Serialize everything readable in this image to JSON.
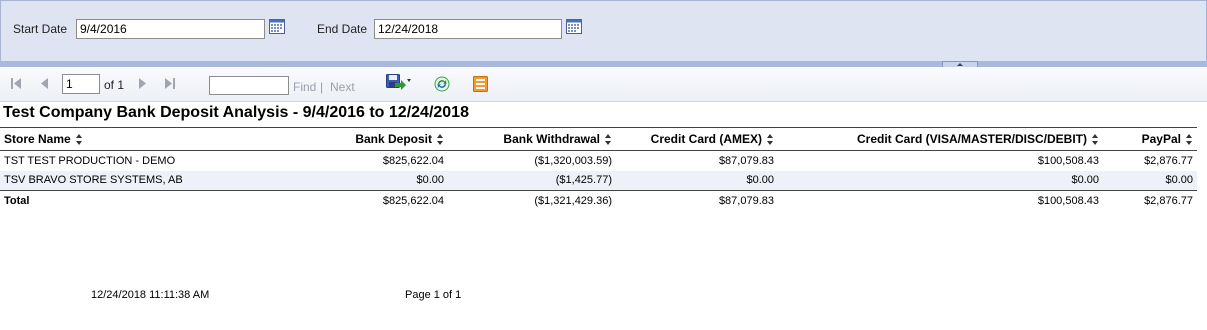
{
  "parameters": {
    "start_date_label": "Start Date",
    "start_date_value": "9/4/2016",
    "end_date_label": "End Date",
    "end_date_value": "12/24/2018"
  },
  "toolbar": {
    "page_number": "1",
    "of_label": "of 1",
    "find_value": "",
    "find_label": "Find",
    "separator": "|",
    "next_label": "Next",
    "icons": [
      "first-page-icon",
      "previous-page-icon",
      "next-page-icon",
      "last-page-icon",
      "export-icon",
      "refresh-icon",
      "print-icon"
    ]
  },
  "report": {
    "title": "Test Company Bank Deposit Analysis - 9/4/2016 to 12/24/2018",
    "columns": [
      "Store Name",
      "Bank Deposit",
      "Bank Withdrawal",
      "Credit Card (AMEX)",
      "Credit Card (VISA/MASTER/DISC/DEBIT)",
      "PayPal"
    ],
    "rows": [
      [
        "TST TEST PRODUCTION - DEMO",
        "$825,622.04",
        "($1,320,003.59)",
        "$87,079.83",
        "$100,508.43",
        "$2,876.77"
      ],
      [
        "TSV BRAVO STORE SYSTEMS, AB",
        "$0.00",
        "($1,425.77)",
        "$0.00",
        "$0.00",
        "$0.00"
      ]
    ],
    "total": [
      "Total",
      "$825,622.04",
      "($1,321,429.36)",
      "$87,079.83",
      "$100,508.43",
      "$2,876.77"
    ]
  },
  "footer": {
    "timestamp": "12/24/2018 11:11:38 AM",
    "page_label": "Page 1 of 1"
  }
}
